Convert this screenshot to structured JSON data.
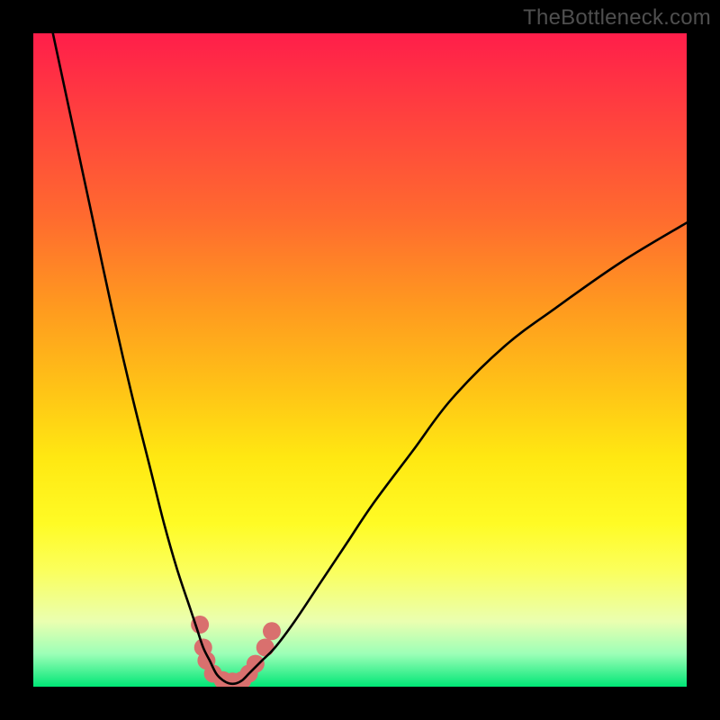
{
  "watermark": "TheBottleneck.com",
  "chart_data": {
    "type": "line",
    "title": "",
    "xlabel": "",
    "ylabel": "",
    "xlim": [
      0,
      100
    ],
    "ylim": [
      0,
      100
    ],
    "background_gradient": {
      "top": "#ff1e4a",
      "middle": "#ffe812",
      "bottom": "#00e676"
    },
    "series": [
      {
        "name": "bottleneck-curve",
        "color": "#000000",
        "x": [
          3,
          6,
          9,
          12,
          15,
          18,
          20,
          22,
          24,
          25,
          26,
          27,
          28,
          29,
          30,
          31,
          32,
          33,
          34,
          35,
          37,
          40,
          44,
          48,
          52,
          58,
          64,
          72,
          80,
          90,
          100
        ],
        "y": [
          100,
          86,
          72,
          58,
          45,
          33,
          25,
          18,
          12,
          9,
          6,
          4,
          2,
          1,
          0.5,
          0.5,
          1,
          2,
          3,
          4,
          6,
          10,
          16,
          22,
          28,
          36,
          44,
          52,
          58,
          65,
          71
        ]
      }
    ],
    "markers": [
      {
        "name": "highlight-dots",
        "color": "#d9706e",
        "radius": 10,
        "points": [
          {
            "x": 25.5,
            "y": 9.5
          },
          {
            "x": 26.0,
            "y": 6.0
          },
          {
            "x": 26.5,
            "y": 4.0
          },
          {
            "x": 27.5,
            "y": 2.0
          },
          {
            "x": 29.0,
            "y": 1.0
          },
          {
            "x": 30.5,
            "y": 0.8
          },
          {
            "x": 32.0,
            "y": 1.0
          },
          {
            "x": 33.0,
            "y": 2.0
          },
          {
            "x": 34.0,
            "y": 3.5
          },
          {
            "x": 35.5,
            "y": 6.0
          },
          {
            "x": 36.5,
            "y": 8.5
          }
        ]
      }
    ]
  }
}
